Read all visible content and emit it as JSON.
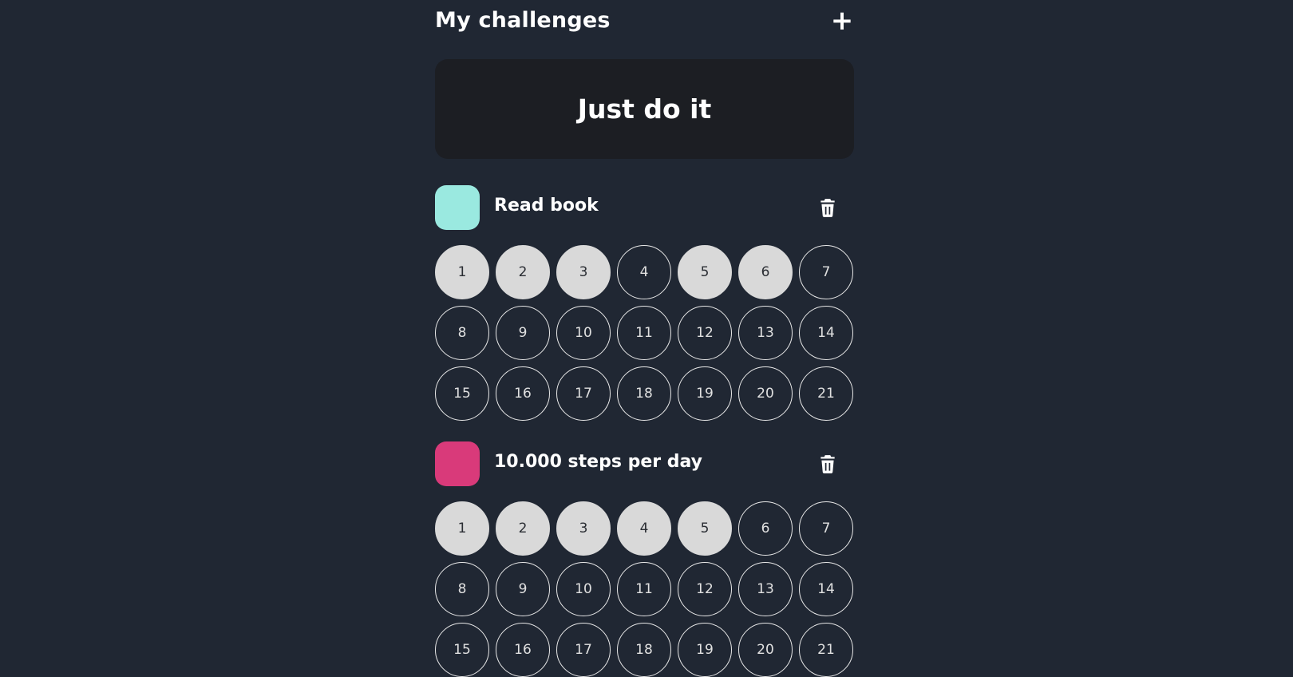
{
  "header": {
    "title": "My challenges",
    "add_label": "+"
  },
  "motto": "Just do it",
  "challenges": [
    {
      "title": "Read book",
      "color": "#9ae9e0",
      "days": [
        "1",
        "2",
        "3",
        "4",
        "5",
        "6",
        "7",
        "8",
        "9",
        "10",
        "11",
        "12",
        "13",
        "14",
        "15",
        "16",
        "17",
        "18",
        "19",
        "20",
        "21"
      ],
      "completed": [
        1,
        2,
        3,
        5,
        6
      ]
    },
    {
      "title": "10.000 steps per day",
      "color": "#d93a7a",
      "days": [
        "1",
        "2",
        "3",
        "4",
        "5",
        "6",
        "7",
        "8",
        "9",
        "10",
        "11",
        "12",
        "13",
        "14",
        "15",
        "16",
        "17",
        "18",
        "19",
        "20",
        "21"
      ],
      "completed": [
        1,
        2,
        3,
        4,
        5
      ]
    }
  ],
  "icons": {
    "add": "plus-icon",
    "delete": "trash-icon"
  }
}
